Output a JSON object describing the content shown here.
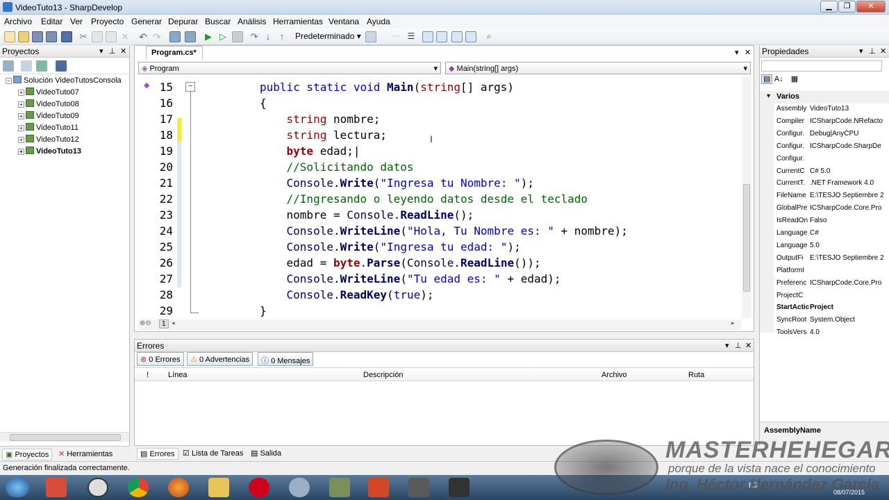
{
  "window": {
    "title": "VideoTuto13 - SharpDevelop"
  },
  "menu": [
    "Archivo",
    "Editar",
    "Ver",
    "Proyecto",
    "Generar",
    "Depurar",
    "Buscar",
    "Análisis",
    "Herramientas",
    "Ventana",
    "Ayuda"
  ],
  "toolbar": {
    "config": "Predeterminado"
  },
  "projects_panel": {
    "title": "Proyectos",
    "solution": "Solución VideoTutosConsola",
    "items": [
      "VideoTuto07",
      "VideoTuto08",
      "VideoTuto09",
      "VideoTuto11",
      "VideoTuto12",
      "VideoTuto13"
    ],
    "tabs": [
      "Proyectos",
      "Herramientas"
    ]
  },
  "editor": {
    "tab": "Program.cs*",
    "class_combo": "Program",
    "member_combo": "Main(string[] args)",
    "line_numbers": [
      "15",
      "16",
      "17",
      "18",
      "19",
      "20",
      "21",
      "22",
      "23",
      "24",
      "25",
      "26",
      "27",
      "28",
      "29"
    ],
    "zoom": "1"
  },
  "errors_panel": {
    "title": "Errores",
    "buttons": [
      "0 Errores",
      "0 Advertencias",
      "0 Mensajes"
    ],
    "columns": [
      "!",
      "Línea",
      "Descripción",
      "Archivo",
      "Ruta"
    ],
    "tabs": [
      "Errores",
      "Lista de Tareas",
      "Salida"
    ]
  },
  "properties_panel": {
    "title": "Propiedades",
    "category": "Varios",
    "rows": [
      [
        "Assembly",
        "VideoTuto13"
      ],
      [
        "Compiler",
        "ICSharpCode.NRefacto"
      ],
      [
        "Configur.",
        "Debug|AnyCPU"
      ],
      [
        "Configur.",
        "ICSharpCode.SharpDe"
      ],
      [
        "Configur.",
        ""
      ],
      [
        "CurrentC",
        "C# 5.0"
      ],
      [
        "CurrentT.",
        ".NET Framework 4.0"
      ],
      [
        "FileName",
        "E:\\TESJO Septiembre 2"
      ],
      [
        "GlobalPre",
        "ICSharpCode.Core.Pro"
      ],
      [
        "IsReadOn",
        "Falso"
      ],
      [
        "Language",
        "C#"
      ],
      [
        "Language",
        "5.0"
      ],
      [
        "OutputFi",
        "E:\\TESJO Septiembre 2"
      ],
      [
        "PlatformI",
        ""
      ],
      [
        "Preferenc",
        "ICSharpCode.Core.Pro"
      ],
      [
        "ProjectC",
        ""
      ],
      [
        "StartActic",
        "Project"
      ],
      [
        "SyncRoot",
        "System.Object"
      ],
      [
        "ToolsVers",
        "4.0"
      ]
    ],
    "description_title": "AssemblyName"
  },
  "status": {
    "text": "Generación finalizada correctamente."
  },
  "watermark": {
    "name": "MASTERHEHEGAR",
    "tagline": "porque de la vista nace el conocimiento",
    "author": "Ing. Héctor Hernández García"
  },
  "taskbar": {
    "lang": "ES",
    "date": "08/07/2015"
  }
}
